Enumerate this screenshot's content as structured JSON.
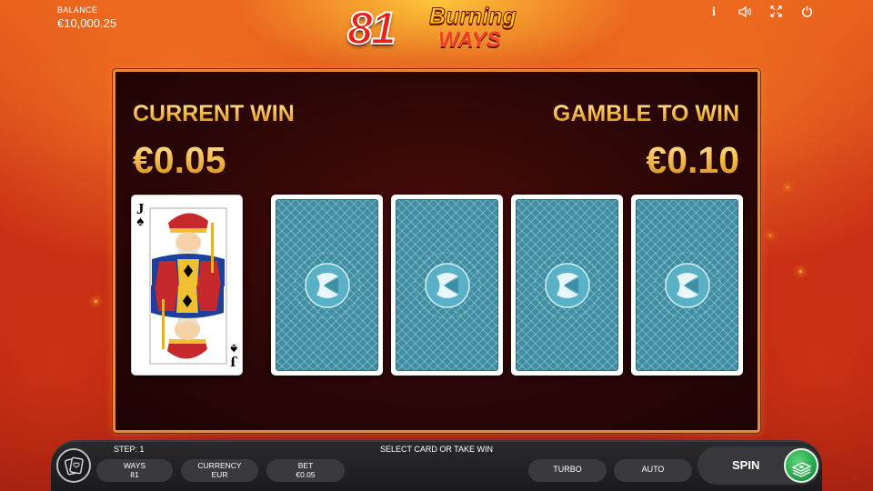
{
  "header": {
    "balance_label": "BALANCE",
    "balance_value": "€10,000.25",
    "logo": {
      "number": "81",
      "word1": "Burning",
      "word2": "WAYS"
    },
    "icons": [
      "info-icon",
      "sound-icon",
      "fullscreen-icon",
      "power-icon"
    ],
    "info_glyph": "i"
  },
  "gamble": {
    "current_win_label": "CURRENT WIN",
    "current_win_value": "€0.05",
    "gamble_to_win_label": "GAMBLE TO WIN",
    "gamble_to_win_value": "€0.10",
    "revealed_card": {
      "rank": "J",
      "suit": "♠"
    },
    "face_down_cards": 4
  },
  "footer": {
    "step": "STEP: 1",
    "message": "SELECT CARD OR TAKE WIN",
    "ways": {
      "label": "WAYS",
      "value": "81"
    },
    "currency": {
      "label": "CURRENCY",
      "value": "EUR"
    },
    "bet": {
      "label": "BET",
      "value": "€0.05"
    },
    "turbo_label": "TURBO",
    "auto_label": "AUTO",
    "spin_label": "SPIN"
  },
  "colors": {
    "panel_border": "#e48a3a",
    "gold_text": "#f2c160",
    "card_back": "#3d8ea2",
    "spin_button": "#27a64a"
  }
}
